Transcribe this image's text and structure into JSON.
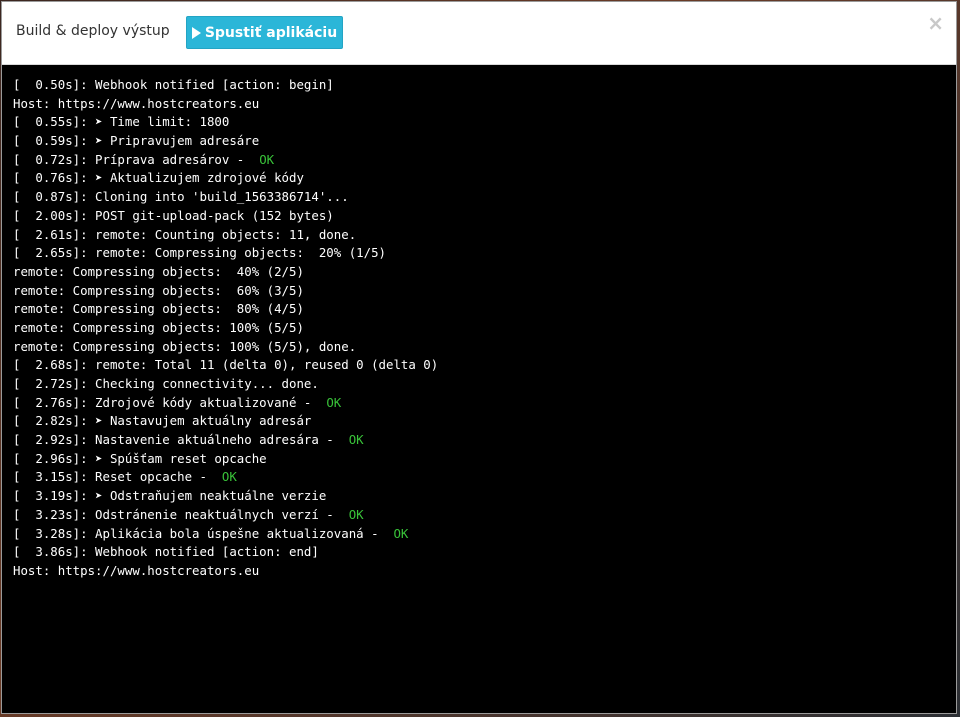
{
  "modal": {
    "title": "Build & deploy výstup",
    "run_button_label": "Spustiť aplikáciu",
    "close_glyph": "×"
  },
  "console": {
    "status_color": "#39c339",
    "lines": [
      {
        "text": "[  0.50s]: Webhook notified [action: begin]",
        "status": ""
      },
      {
        "text": "Host: https://www.hostcreators.eu",
        "status": ""
      },
      {
        "text": "[  0.55s]: ➤ Time limit: 1800",
        "status": ""
      },
      {
        "text": "[  0.59s]: ➤ Pripravujem adresáre",
        "status": ""
      },
      {
        "text": "[  0.72s]: Príprava adresárov -  ",
        "status": "OK"
      },
      {
        "text": "[  0.76s]: ➤ Aktualizujem zdrojové kódy",
        "status": ""
      },
      {
        "text": "[  0.87s]: Cloning into 'build_1563386714'...",
        "status": ""
      },
      {
        "text": "[  2.00s]: POST git-upload-pack (152 bytes)",
        "status": ""
      },
      {
        "text": "[  2.61s]: remote: Counting objects: 11, done.",
        "status": ""
      },
      {
        "text": "[  2.65s]: remote: Compressing objects:  20% (1/5)",
        "status": ""
      },
      {
        "text": "remote: Compressing objects:  40% (2/5)",
        "status": ""
      },
      {
        "text": "remote: Compressing objects:  60% (3/5)",
        "status": ""
      },
      {
        "text": "remote: Compressing objects:  80% (4/5)",
        "status": ""
      },
      {
        "text": "remote: Compressing objects: 100% (5/5)",
        "status": ""
      },
      {
        "text": "remote: Compressing objects: 100% (5/5), done.",
        "status": ""
      },
      {
        "text": "[  2.68s]: remote: Total 11 (delta 0), reused 0 (delta 0)",
        "status": ""
      },
      {
        "text": "[  2.72s]: Checking connectivity... done.",
        "status": ""
      },
      {
        "text": "[  2.76s]: Zdrojové kódy aktualizované -  ",
        "status": "OK"
      },
      {
        "text": "[  2.82s]: ➤ Nastavujem aktuálny adresár",
        "status": ""
      },
      {
        "text": "[  2.92s]: Nastavenie aktuálneho adresára -  ",
        "status": "OK"
      },
      {
        "text": "[  2.96s]: ➤ Spúšťam reset opcache",
        "status": ""
      },
      {
        "text": "[  3.15s]: Reset opcache -  ",
        "status": "OK"
      },
      {
        "text": "[  3.19s]: ➤ Odstraňujem neaktuálne verzie",
        "status": ""
      },
      {
        "text": "[  3.23s]: Odstránenie neaktuálnych verzí -  ",
        "status": "OK"
      },
      {
        "text": "[  3.28s]: Aplikácia bola úspešne aktualizovaná -  ",
        "status": "OK"
      },
      {
        "text": "[  3.86s]: Webhook notified [action: end]",
        "status": ""
      },
      {
        "text": "Host: https://www.hostcreators.eu",
        "status": ""
      }
    ]
  }
}
